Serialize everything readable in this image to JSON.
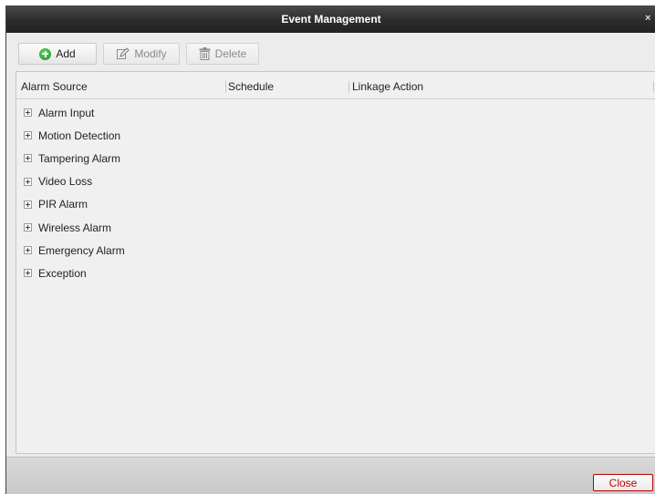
{
  "window": {
    "title": "Event Management",
    "close_glyph": "×"
  },
  "toolbar": {
    "add_label": "Add",
    "modify_label": "Modify",
    "delete_label": "Delete",
    "icons": [
      "add-icon",
      "edit-icon",
      "trash-icon"
    ],
    "accent_add": "#1f8f2a"
  },
  "table": {
    "columns": [
      "Alarm Source",
      "Schedule",
      "Linkage Action"
    ],
    "rows": [
      {
        "label": "Alarm Input",
        "expanded": false
      },
      {
        "label": "Motion Detection",
        "expanded": false
      },
      {
        "label": "Tampering Alarm",
        "expanded": false
      },
      {
        "label": "Video Loss",
        "expanded": false
      },
      {
        "label": "PIR Alarm",
        "expanded": false
      },
      {
        "label": "Wireless Alarm",
        "expanded": false
      },
      {
        "label": "Emergency Alarm",
        "expanded": false
      },
      {
        "label": "Exception",
        "expanded": false
      }
    ]
  },
  "footer": {
    "close_label": "Close",
    "close_color": "#c00000"
  }
}
